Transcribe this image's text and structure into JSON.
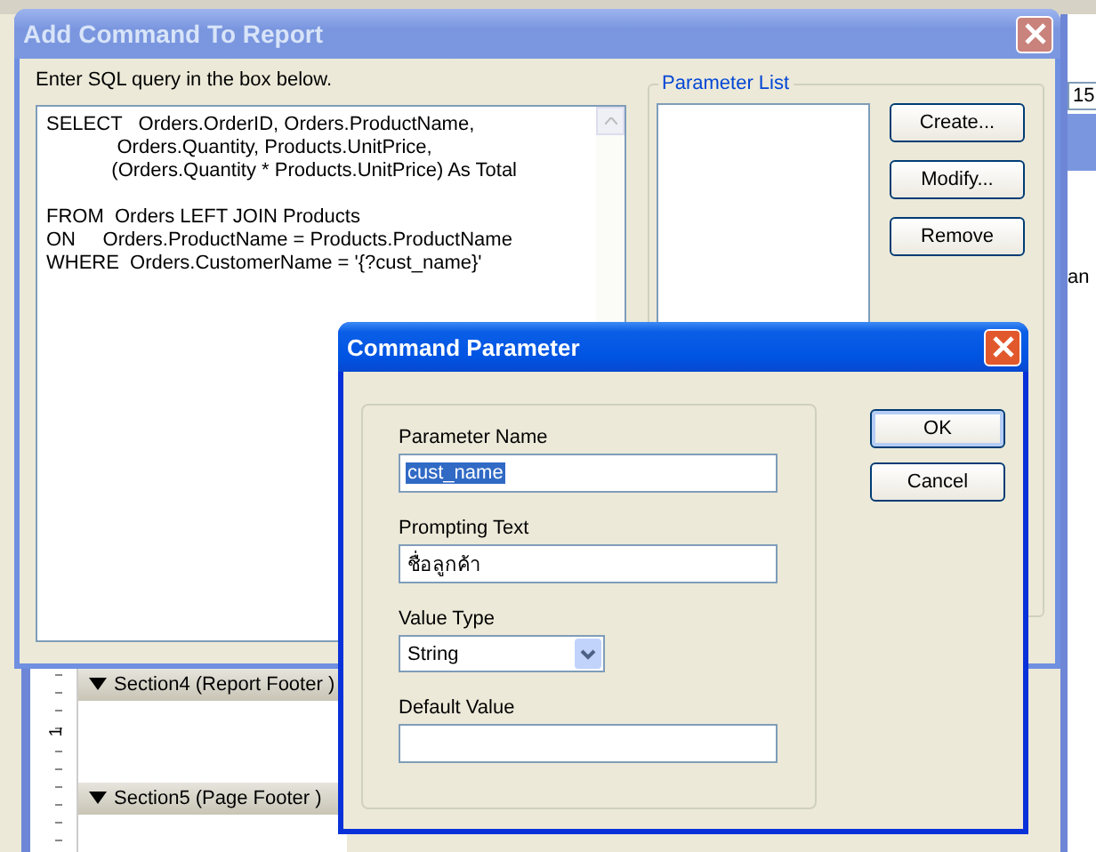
{
  "background": {
    "zoom_field": "15",
    "cut_text": "an",
    "ruler_label": "1",
    "sections": [
      {
        "title": "Section4 (Report Footer )",
        "expanded": true
      },
      {
        "title": "Section5 (Page Footer )",
        "expanded": true
      }
    ]
  },
  "add_command_dialog": {
    "title": "Add Command To Report",
    "instruction": "Enter SQL query in the box below.",
    "sql": "SELECT   Orders.OrderID, Orders.ProductName,\n             Orders.Quantity, Products.UnitPrice,\n            (Orders.Quantity * Products.UnitPrice) As Total\n\nFROM  Orders LEFT JOIN Products\nON     Orders.ProductName = Products.ProductName\nWHERE  Orders.CustomerName = '{?cust_name}'",
    "parameter_list_label": "Parameter List",
    "buttons": [
      "Create...",
      "Modify...",
      "Remove"
    ]
  },
  "parameter_dialog": {
    "title": "Command Parameter",
    "fields": [
      {
        "kind": "text",
        "label": "Parameter Name",
        "value": "cust_name",
        "selected": true
      },
      {
        "kind": "text",
        "label": "Prompting Text",
        "value": "ชื่อลูกค้า",
        "selected": false
      },
      {
        "kind": "select",
        "label": "Value Type",
        "value": "String",
        "selected": false
      },
      {
        "kind": "text",
        "label": "Default Value"
      }
    ],
    "buttons": [
      "OK",
      "Cancel"
    ]
  }
}
